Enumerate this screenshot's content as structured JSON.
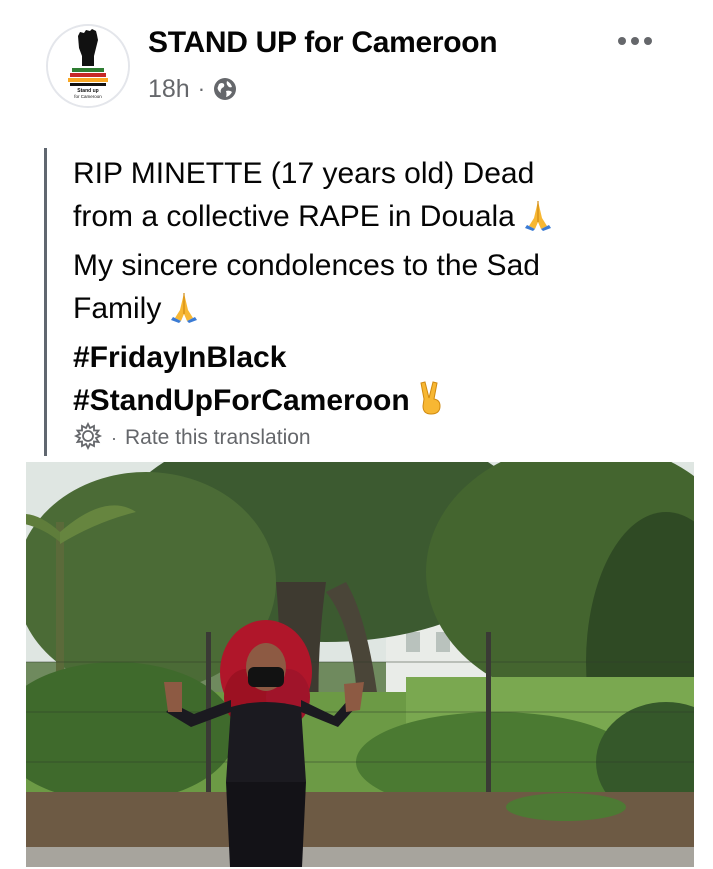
{
  "post": {
    "author": "STAND UP for Cameroon",
    "avatar_text_1": "Stand up",
    "avatar_text_2": "for Cameroon",
    "time": "18h",
    "meta_separator": "·",
    "privacy_icon": "globe-icon",
    "more_icon": "more-horizontal-icon",
    "text_lines": [
      "RIP MINETTE (17 years old) Dead",
      "from a collective RAPE in Douala",
      "My sincere condolences to the Sad",
      "Family"
    ],
    "hashtags": [
      "#FridayInBlack",
      "#StandUpForCameroon"
    ],
    "emojis": [
      "folded-hands-emoji",
      "folded-hands-emoji",
      "victory-hand-emoji"
    ],
    "translation": {
      "icon": "gear-icon",
      "separator": "·",
      "label": "Rate this translation"
    },
    "photo": {
      "subject": "photo"
    }
  },
  "colors": {
    "primary_text": "#050505",
    "secondary_text": "#65676b",
    "quote_bar": "#606770"
  }
}
